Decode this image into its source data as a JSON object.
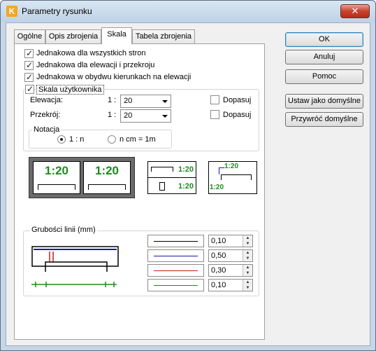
{
  "window": {
    "title": "Parametry rysunku",
    "close_glyph": "✕"
  },
  "tabs": [
    {
      "label": "Ogólne"
    },
    {
      "label": "Opis zbrojenia"
    },
    {
      "label": "Skala",
      "active": true
    },
    {
      "label": "Tabela zbrojenia"
    }
  ],
  "options": [
    {
      "label": "Jednakowa dla wszystkich stron",
      "checked": true
    },
    {
      "label": "Jednakowa dla elewacji i przekroju",
      "checked": true
    },
    {
      "label": "Jednakowa w obydwu kierunkach na elewacji",
      "checked": true
    }
  ],
  "user_scale": {
    "label": "Skala użytkownika",
    "checked": true,
    "rows": [
      {
        "label": "Elewacja:",
        "ratio_prefix": "1 :",
        "value": "20",
        "fit_label": "Dopasuj",
        "fit_checked": false
      },
      {
        "label": "Przekrój:",
        "ratio_prefix": "1 :",
        "value": "20",
        "fit_label": "Dopasuj",
        "fit_checked": false
      }
    ],
    "notation": {
      "title": "Notacja",
      "options": [
        {
          "label": "1 : n",
          "selected": true
        },
        {
          "label": "n cm = 1m",
          "selected": false
        }
      ]
    }
  },
  "previews": {
    "scale_text": "1:20"
  },
  "line_thickness": {
    "title": "Grubości linii (mm)",
    "rows": [
      {
        "value": "0,10",
        "color": "#000000"
      },
      {
        "value": "0,50",
        "color": "#1a1aa6"
      },
      {
        "value": "0,30",
        "color": "#cc1a1a"
      },
      {
        "value": "0,10",
        "color": "#1e8a1e"
      }
    ]
  },
  "buttons": {
    "ok": "OK",
    "cancel": "Anuluj",
    "help": "Pomoc",
    "set_default": "Ustaw jako domyślne",
    "restore_default": "Przywróć domyślne"
  },
  "colors": {
    "green": "#1e8a1e",
    "blue": "#1a1aa6",
    "red": "#cc1a1a"
  }
}
